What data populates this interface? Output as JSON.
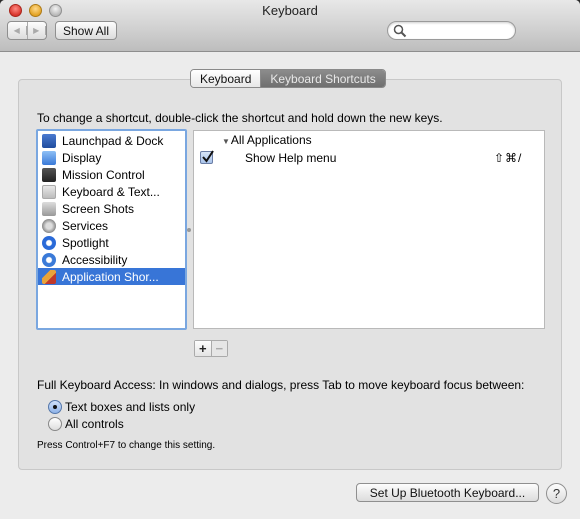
{
  "window": {
    "title": "Keyboard"
  },
  "toolbar": {
    "back_icon": "triangle-left",
    "forward_icon": "triangle-right",
    "show_all_label": "Show All",
    "search_placeholder": "",
    "search_value": ""
  },
  "tabs": [
    {
      "label": "Keyboard",
      "selected": false
    },
    {
      "label": "Keyboard Shortcuts",
      "selected": true
    }
  ],
  "instructions": "To change a shortcut, double-click the shortcut and hold down the new keys.",
  "categories": [
    {
      "label": "Launchpad & Dock",
      "icon": "launchpad-dock-icon",
      "color": "#2a5db0",
      "selected": false
    },
    {
      "label": "Display",
      "icon": "display-icon",
      "color": "#4a8de0",
      "selected": false
    },
    {
      "label": "Mission Control",
      "icon": "mission-control-icon",
      "color": "#3a3a3a",
      "selected": false
    },
    {
      "label": "Keyboard & Text...",
      "icon": "keyboard-icon",
      "color": "#c8c8c8",
      "selected": false
    },
    {
      "label": "Screen Shots",
      "icon": "screenshot-icon",
      "color": "#9a9a9a",
      "selected": false
    },
    {
      "label": "Services",
      "icon": "gear-icon",
      "color": "#8a8a8a",
      "selected": false
    },
    {
      "label": "Spotlight",
      "icon": "spotlight-icon",
      "color": "#2a6ad8",
      "selected": false
    },
    {
      "label": "Accessibility",
      "icon": "accessibility-icon",
      "color": "#3a7ad8",
      "selected": false
    },
    {
      "label": "Application Shor...",
      "icon": "app-shortcuts-icon",
      "color": "#e8a33a",
      "selected": true
    }
  ],
  "shortcuts": {
    "group_label": "All Applications",
    "items": [
      {
        "checked": true,
        "action": "Show Help menu",
        "keys": "⇧⌘/"
      }
    ]
  },
  "list_controls": {
    "add_label": "+",
    "remove_label": "−"
  },
  "full_keyboard_access": {
    "label": "Full Keyboard Access: In windows and dialogs, press Tab to move keyboard focus between:",
    "options": [
      {
        "label": "Text boxes and lists only",
        "selected": true
      },
      {
        "label": "All controls",
        "selected": false
      }
    ],
    "note": "Press Control+F7 to change this setting."
  },
  "footer": {
    "bluetooth_button_label": "Set Up Bluetooth Keyboard...",
    "help_label": "?"
  },
  "colors": {
    "selection": "#3875d7",
    "focus_ring": "#7aa7e0"
  }
}
